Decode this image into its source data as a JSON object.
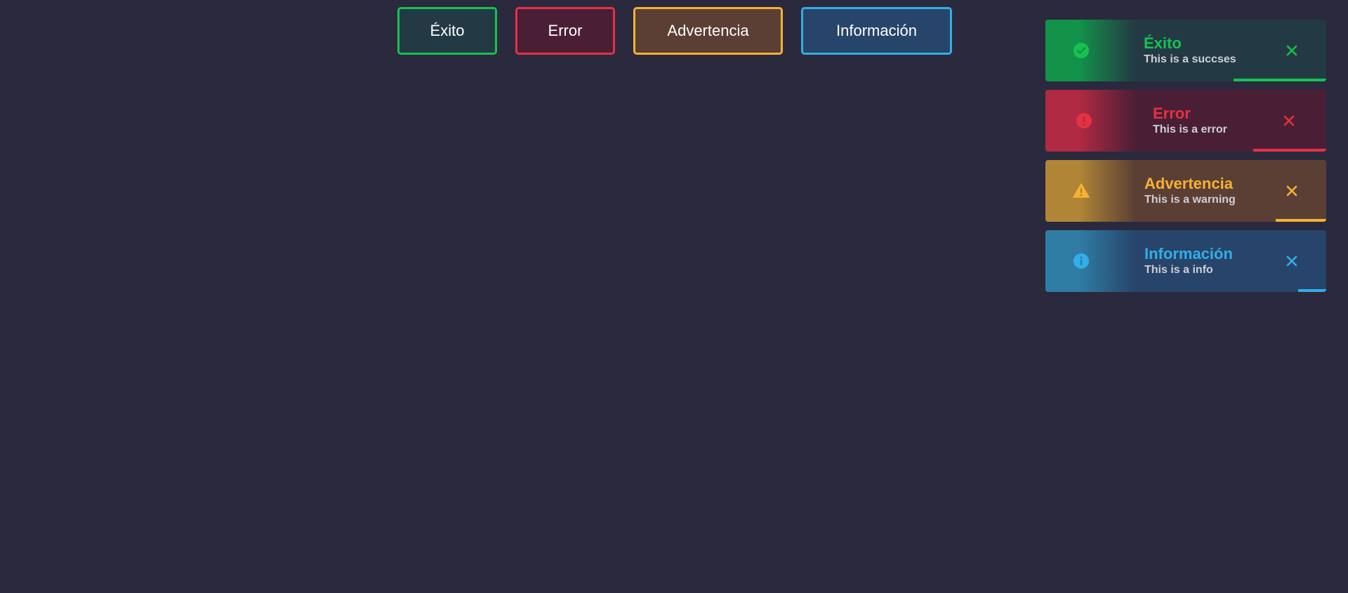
{
  "buttons": {
    "success": "Éxito",
    "error": "Error",
    "warning": "Advertencia",
    "info": "Información"
  },
  "toasts": [
    {
      "type": "success",
      "title": "Éxito",
      "message": "This is a succses",
      "icon": "check-circle-icon",
      "close_icon": "close-icon",
      "progress": 0.33,
      "color": "#16c24f"
    },
    {
      "type": "error",
      "title": "Error",
      "message": "This is a error",
      "icon": "exclamation-circle-icon",
      "close_icon": "close-icon",
      "progress": 0.26,
      "color": "#e53242"
    },
    {
      "type": "warning",
      "title": "Advertencia",
      "message": "This is a warning",
      "icon": "warning-triangle-icon",
      "close_icon": "close-icon",
      "progress": 0.18,
      "color": "#f5b233"
    },
    {
      "type": "info",
      "title": "Información",
      "message": "This is a info",
      "icon": "info-circle-icon",
      "close_icon": "close-icon",
      "progress": 0.1,
      "color": "#32aee8"
    }
  ]
}
